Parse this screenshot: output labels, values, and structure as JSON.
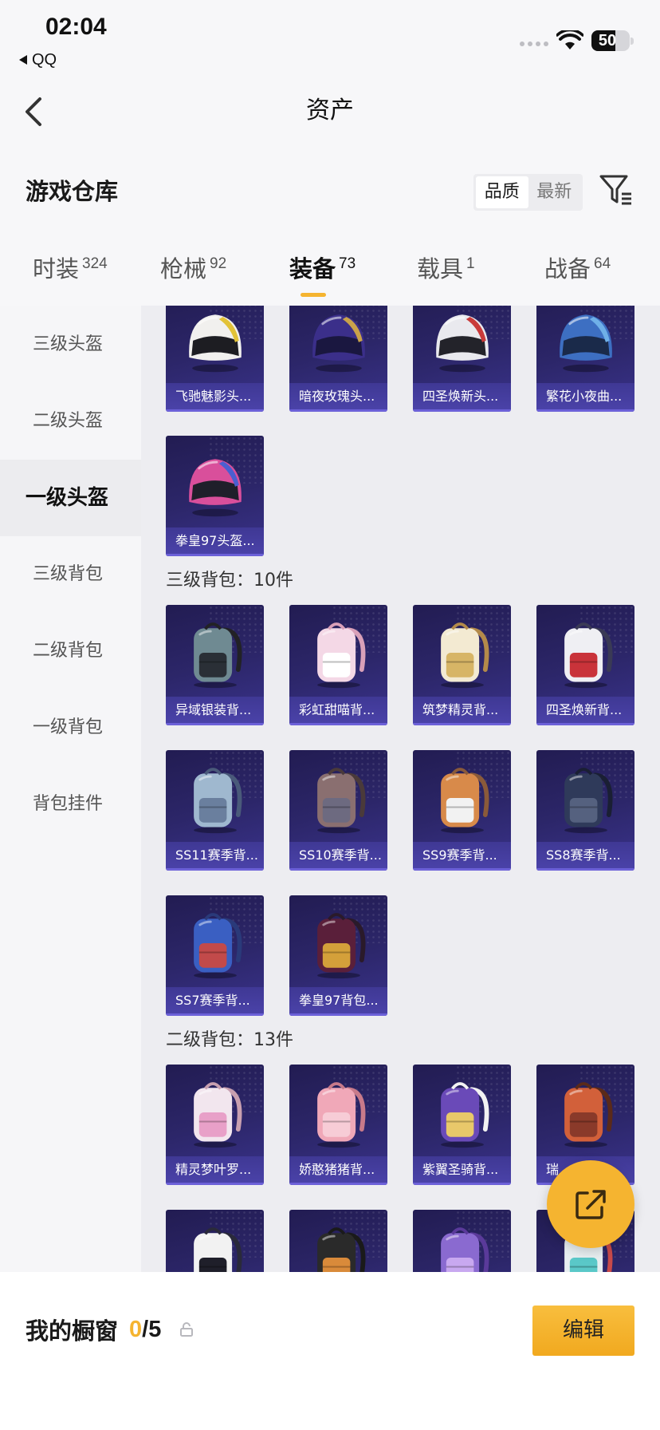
{
  "status_bar": {
    "time": "02:04",
    "back_app": "QQ",
    "battery": "50"
  },
  "header": {
    "title": "资产"
  },
  "warehouse": {
    "title": "游戏仓库",
    "sort_options": [
      "品质",
      "最新"
    ],
    "sort_active": "品质"
  },
  "tabs": [
    {
      "label": "时装",
      "count": "324"
    },
    {
      "label": "枪械",
      "count": "92"
    },
    {
      "label": "装备",
      "count": "73",
      "active": true
    },
    {
      "label": "载具",
      "count": "1"
    },
    {
      "label": "战备",
      "count": "64"
    }
  ],
  "sidebar": [
    {
      "label": "三级头盔"
    },
    {
      "label": "二级头盔"
    },
    {
      "label": "一级头盔",
      "active": true
    },
    {
      "label": "三级背包"
    },
    {
      "label": "二级背包"
    },
    {
      "label": "一级背包"
    },
    {
      "label": "背包挂件"
    }
  ],
  "groups": [
    {
      "items": [
        {
          "label": "飞驰魅影头...",
          "icon": "helmet-icon",
          "colors": [
            "#f1f0ee",
            "#e2c238",
            "#1d1d22"
          ]
        },
        {
          "label": "暗夜玫瑰头...",
          "icon": "helmet-icon",
          "colors": [
            "#3b2f8a",
            "#c9a24a",
            "#1a1740"
          ]
        },
        {
          "label": "四圣焕新头...",
          "icon": "helmet-icon",
          "colors": [
            "#e9e9ee",
            "#c93a3a",
            "#23232a"
          ]
        },
        {
          "label": "繁花小夜曲...",
          "icon": "helmet-icon",
          "colors": [
            "#3d6fc2",
            "#6fb0e8",
            "#1a2a4a"
          ]
        },
        {
          "label": "拳皇97头盔...",
          "icon": "helmet-icon",
          "colors": [
            "#d94f9b",
            "#4b5fd0",
            "#1f1f2a"
          ]
        }
      ]
    },
    {
      "header": "三级背包：10件",
      "items": [
        {
          "label": "异域银装背...",
          "icon": "backpack-icon",
          "colors": [
            "#6f8a92",
            "#2a2f36",
            "#222226"
          ]
        },
        {
          "label": "彩虹甜喵背...",
          "icon": "backpack-icon",
          "colors": [
            "#f4d8e6",
            "#ffffff",
            "#d9a0b8"
          ]
        },
        {
          "label": "筑梦精灵背...",
          "icon": "backpack-icon",
          "colors": [
            "#f3ead2",
            "#d7b566",
            "#b38a4a"
          ]
        },
        {
          "label": "四圣焕新背...",
          "icon": "backpack-icon",
          "colors": [
            "#efeff3",
            "#c9333a",
            "#3a3a55"
          ]
        },
        {
          "label": "SS11赛季背...",
          "icon": "backpack-icon",
          "colors": [
            "#9fb8cf",
            "#6a7f9e",
            "#4a5a7a"
          ]
        },
        {
          "label": "SS10赛季背...",
          "icon": "backpack-icon",
          "colors": [
            "#8a6f70",
            "#6d6a80",
            "#4a3a3a"
          ]
        },
        {
          "label": "SS9赛季背...",
          "icon": "backpack-icon",
          "colors": [
            "#d88a4a",
            "#f2f2f2",
            "#8a5a3a"
          ]
        },
        {
          "label": "SS8赛季背...",
          "icon": "backpack-icon",
          "colors": [
            "#2f3a5a",
            "#55617f",
            "#1a1f33"
          ]
        },
        {
          "label": "SS7赛季背...",
          "icon": "backpack-icon",
          "colors": [
            "#3a5fc2",
            "#c24a4a",
            "#2a3a7a"
          ]
        },
        {
          "label": "拳皇97背包...",
          "icon": "backpack-icon",
          "colors": [
            "#5a1f3a",
            "#d4a03a",
            "#2a1a2a"
          ]
        }
      ]
    },
    {
      "header": "二级背包：13件",
      "items": [
        {
          "label": "精灵梦叶罗...",
          "icon": "backpack-icon",
          "colors": [
            "#f2e6ee",
            "#e8a0c8",
            "#c8a0b0"
          ]
        },
        {
          "label": "娇憨猪猪背...",
          "icon": "backpack-icon",
          "colors": [
            "#f0a8b8",
            "#f7ccd6",
            "#c87a8a"
          ]
        },
        {
          "label": "紫翼圣骑背...",
          "icon": "backpack-icon",
          "colors": [
            "#6a4ab8",
            "#e8c86a",
            "#f2f2f2"
          ]
        },
        {
          "label": "瑞",
          "icon": "backpack-icon",
          "colors": [
            "#d2603a",
            "#8a3a2a",
            "#5a2a1a"
          ]
        },
        {
          "icon": "backpack-icon",
          "colors": [
            "#f2f2f2",
            "#1f1f2a",
            "#2a2a3a"
          ]
        },
        {
          "icon": "backpack-icon",
          "colors": [
            "#2a2a2a",
            "#d98a3a",
            "#1a1a1a"
          ]
        },
        {
          "icon": "backpack-icon",
          "colors": [
            "#8a6ad0",
            "#c8a8f0",
            "#5a3a9a"
          ]
        },
        {
          "icon": "backpack-icon",
          "colors": [
            "#e8eef0",
            "#5ac8c8",
            "#c84a4a"
          ]
        }
      ]
    }
  ],
  "showcase": {
    "title": "我的橱窗",
    "used": "0",
    "total": "/5",
    "edit_label": "编辑"
  },
  "colors": {
    "accent": "#f5b430",
    "card_bg": "#2c2669"
  }
}
